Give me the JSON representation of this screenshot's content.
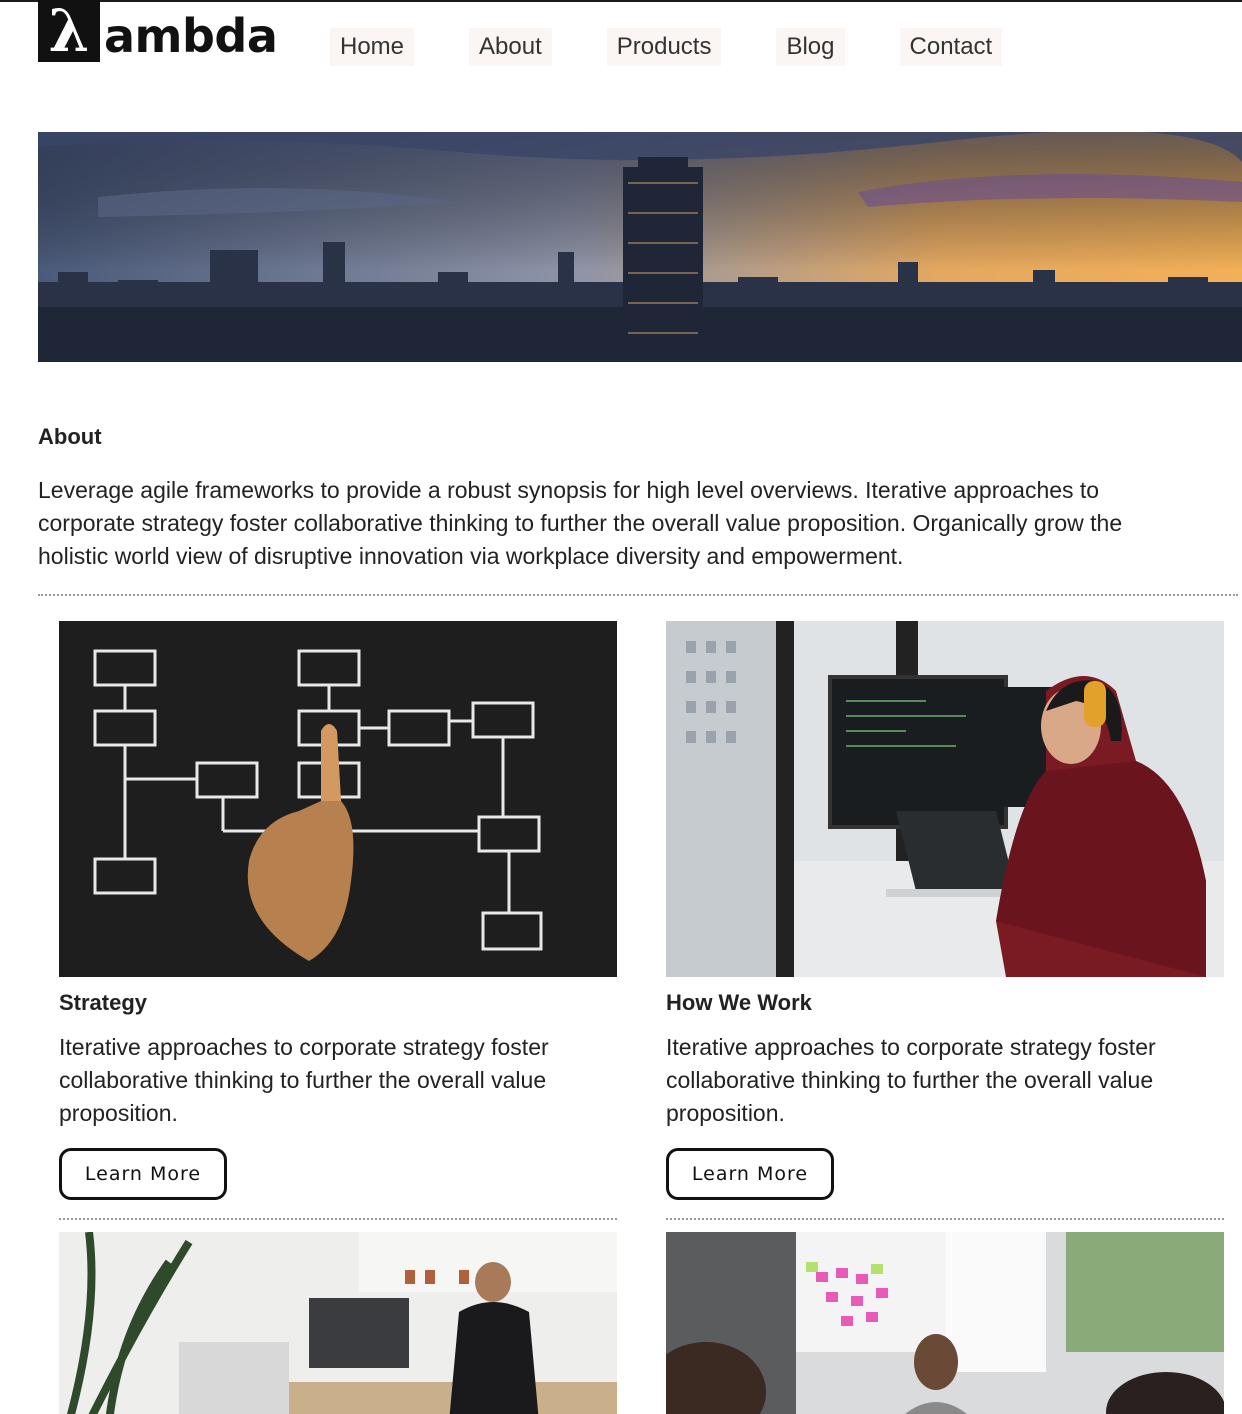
{
  "brand": {
    "logo_mark": "λ",
    "logo_text": "ambda"
  },
  "nav": {
    "items": [
      "Home",
      "About",
      "Products",
      "Blog",
      "Contact"
    ]
  },
  "hero": {
    "image": "city-skyline-sunset"
  },
  "about": {
    "title": "About",
    "text": "Leverage agile frameworks to provide a robust synopsis for high level overviews. Iterative approaches to corporate strategy foster collaborative thinking to further the overall value proposition. Organically grow the holistic world view of disruptive innovation via workplace diversity and empowerment."
  },
  "cards": [
    {
      "image": "flowchart-chalkboard",
      "title": "Strategy",
      "text": "Iterative approaches to corporate strategy foster collaborative thinking to further the overall value proposition.",
      "button": "Learn More"
    },
    {
      "image": "developer-at-monitors",
      "title": "How We Work",
      "text": "Iterative approaches to corporate strategy foster collaborative thinking to further the overall value proposition.",
      "button": "Learn More"
    }
  ],
  "lower_images": [
    "office-workspace",
    "team-meeting-whiteboard"
  ],
  "colors": {
    "text": "#222222",
    "nav_bg": "#fbf6f3",
    "logo": "#111111",
    "divider": "#999999"
  }
}
